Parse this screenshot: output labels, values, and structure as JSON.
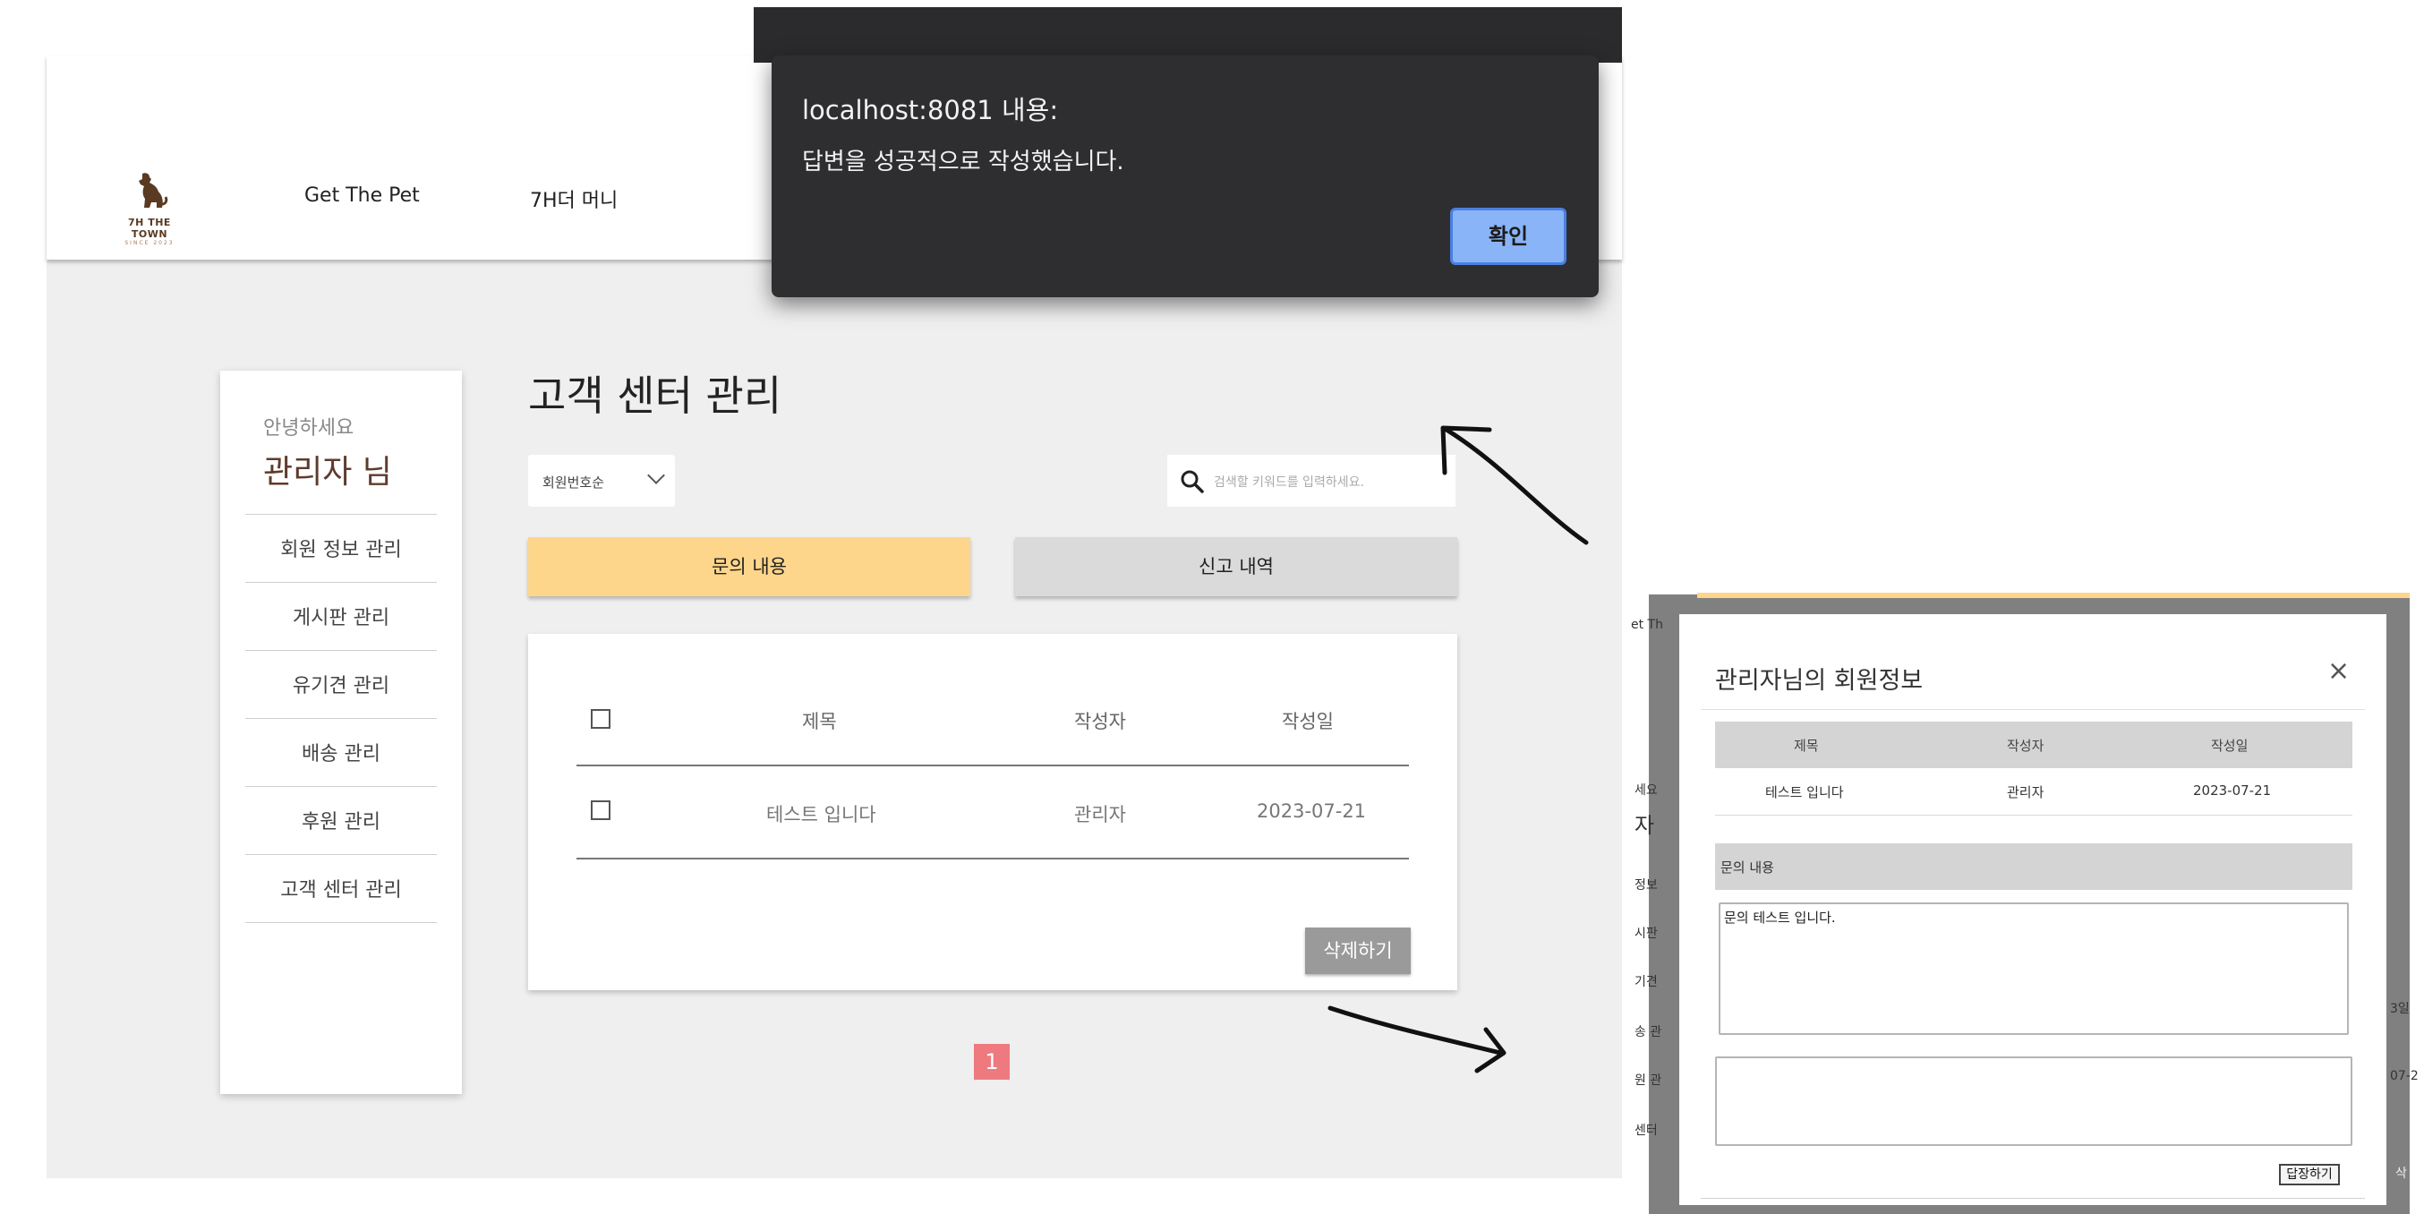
{
  "header": {
    "logo_text": "7H THE TOWN",
    "logo_sub": "SINCE 2023",
    "nav": [
      "Get The Pet",
      "7H더 머니"
    ]
  },
  "sidebar": {
    "greeting": "안녕하세요",
    "user": "관리자 님",
    "items": [
      "회원 정보 관리",
      "게시판 관리",
      "유기견 관리",
      "배송 관리",
      "후원 관리",
      "고객 센터 관리"
    ]
  },
  "main": {
    "title": "고객 센터 관리",
    "sort_select": "회원번호순",
    "search_placeholder": "검색할 키워드를 입력하세요.",
    "tabs": [
      "문의 내용",
      "신고 내역"
    ],
    "table": {
      "headers": [
        "제목",
        "작성자",
        "작성일"
      ],
      "rows": [
        {
          "title": "테스트 입니다",
          "author": "관리자",
          "date": "2023-07-21"
        }
      ]
    },
    "delete_button": "삭제하기",
    "page": "1"
  },
  "alert": {
    "title": "localhost:8081 내용:",
    "message": "답변을 성공적으로 작성했습니다.",
    "ok": "확인"
  },
  "modal": {
    "title": "관리자님의 회원정보",
    "close": "×",
    "headers": [
      "제목",
      "작성자",
      "작성일"
    ],
    "row": {
      "title": "테스트 입니다",
      "author": "관리자",
      "date": "2023-07-21"
    },
    "inquiry_label": "문의 내용",
    "inquiry_text": "문의 테스트 입니다.",
    "reply_button": "답장하기",
    "background_fragments": [
      "et Th",
      "세요",
      "자",
      "정보",
      "시판",
      "기견",
      "송 관",
      "원 관",
      "센터",
      "3일",
      "07-2",
      "삭"
    ]
  },
  "colors": {
    "accent_tab": "#fdd68b",
    "inactive_tab": "#dadada",
    "page_badge": "#ee7a80",
    "brand_brown": "#5e3b2c",
    "alert_bg": "#2e2e30",
    "alert_button": "#8ab4f8"
  },
  "icons": {
    "search": "search-icon",
    "logo": "dog-logo-icon",
    "dropdown": "chevron-down-icon",
    "close": "close-icon"
  }
}
